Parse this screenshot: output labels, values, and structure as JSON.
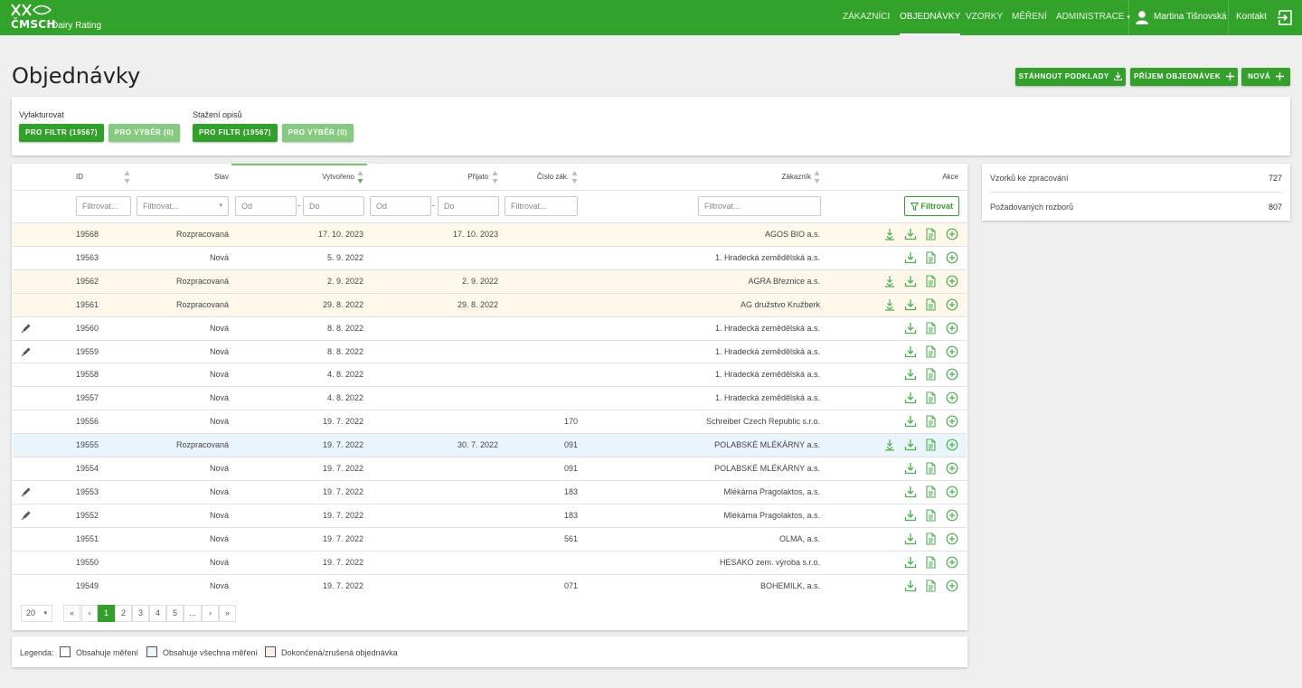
{
  "brand": {
    "logo_text": "ČMSCH",
    "subtitle": "Dairy Rating"
  },
  "nav": {
    "items": [
      "ZÁKAZNÍCI",
      "OBJEDNÁVKY",
      "VZORKY",
      "MĚŘENÍ",
      "ADMINISTRACE"
    ],
    "active": "OBJEDNÁVKY",
    "user_name": "Martina Tišnovská",
    "contact": "Kontakt"
  },
  "page_title": "Objednávky",
  "top_buttons": {
    "download": "STÁHNOUT PODKLADY",
    "receive": "PŘÍJEM OBJEDNÁVEK",
    "new": "NOVÁ"
  },
  "bulk": {
    "invoice_label": "Vyfakturovat",
    "download_label": "Stažení opisů",
    "for_filter": "PRO FILTR (19567)",
    "for_selection": "PRO VÝBĚR (0)"
  },
  "table": {
    "headers": {
      "id": "ID",
      "state": "Stav",
      "created": "Vytvořeno",
      "received": "Přijato",
      "customer_no": "Číslo zák.",
      "customer": "Zákazník",
      "actions": "Akce"
    },
    "filters": {
      "placeholder": "Filtrovat...",
      "from": "Od",
      "to": "Do",
      "dash": "-",
      "button": "Filtrovat"
    },
    "rows": [
      {
        "id": "19568",
        "state": "Rozpracovaná",
        "created": "17. 10. 2023",
        "received": "17. 10. 2023",
        "cust_no": "",
        "customer": "AGOS BIO a.s.",
        "highlight": "yellow",
        "edit": false,
        "extra_dl": true
      },
      {
        "id": "19563",
        "state": "Nová",
        "created": "5. 9. 2022",
        "received": "",
        "cust_no": "",
        "customer": "1. Hradecká zemědělská a.s.",
        "highlight": "",
        "edit": false,
        "extra_dl": false
      },
      {
        "id": "19562",
        "state": "Rozpracovaná",
        "created": "2. 9. 2022",
        "received": "2. 9. 2022",
        "cust_no": "",
        "customer": "AGRA Březnice a.s.",
        "highlight": "yellow",
        "edit": false,
        "extra_dl": true
      },
      {
        "id": "19561",
        "state": "Rozpracovaná",
        "created": "29. 8. 2022",
        "received": "29. 8. 2022",
        "cust_no": "",
        "customer": "AG družstvo Kružberk",
        "highlight": "yellow",
        "edit": false,
        "extra_dl": true
      },
      {
        "id": "19560",
        "state": "Nová",
        "created": "8. 8. 2022",
        "received": "",
        "cust_no": "",
        "customer": "1. Hradecká zemědělská a.s.",
        "highlight": "",
        "edit": true,
        "extra_dl": false
      },
      {
        "id": "19559",
        "state": "Nová",
        "created": "8. 8. 2022",
        "received": "",
        "cust_no": "",
        "customer": "1. Hradecká zemědělská a.s.",
        "highlight": "",
        "edit": true,
        "extra_dl": false
      },
      {
        "id": "19558",
        "state": "Nová",
        "created": "4. 8. 2022",
        "received": "",
        "cust_no": "",
        "customer": "1. Hradecká zemědělská a.s.",
        "highlight": "",
        "edit": false,
        "extra_dl": false
      },
      {
        "id": "19557",
        "state": "Nová",
        "created": "4. 8. 2022",
        "received": "",
        "cust_no": "",
        "customer": "1. Hradecká zemědělská a.s.",
        "highlight": "",
        "edit": false,
        "extra_dl": false
      },
      {
        "id": "19556",
        "state": "Nová",
        "created": "19. 7. 2022",
        "received": "",
        "cust_no": "170",
        "customer": "Schreiber Czech Republic s.r.o.",
        "highlight": "",
        "edit": false,
        "extra_dl": false
      },
      {
        "id": "19555",
        "state": "Rozpracovaná",
        "created": "19. 7. 2022",
        "received": "30. 7. 2022",
        "cust_no": "091",
        "customer": "POLABSKÉ MLÉKÁRNY a.s.",
        "highlight": "blue",
        "edit": false,
        "extra_dl": true
      },
      {
        "id": "19554",
        "state": "Nová",
        "created": "19. 7. 2022",
        "received": "",
        "cust_no": "091",
        "customer": "POLABSKÉ MLÉKÁRNY a.s.",
        "highlight": "",
        "edit": false,
        "extra_dl": false
      },
      {
        "id": "19553",
        "state": "Nová",
        "created": "19. 7. 2022",
        "received": "",
        "cust_no": "183",
        "customer": "Mlékárna Pragolaktos, a.s.",
        "highlight": "",
        "edit": true,
        "extra_dl": false
      },
      {
        "id": "19552",
        "state": "Nová",
        "created": "19. 7. 2022",
        "received": "",
        "cust_no": "183",
        "customer": "Mlékárna Pragolaktos, a.s.",
        "highlight": "",
        "edit": true,
        "extra_dl": false
      },
      {
        "id": "19551",
        "state": "Nová",
        "created": "19. 7. 2022",
        "received": "",
        "cust_no": "561",
        "customer": "OLMA, a.s.",
        "highlight": "",
        "edit": false,
        "extra_dl": false
      },
      {
        "id": "19550",
        "state": "Nová",
        "created": "19. 7. 2022",
        "received": "",
        "cust_no": "",
        "customer": "HESAKO zem. výroba s.r.o.",
        "highlight": "",
        "edit": false,
        "extra_dl": false
      },
      {
        "id": "19549",
        "state": "Nová",
        "created": "19. 7. 2022",
        "received": "",
        "cust_no": "071",
        "customer": "BOHEMILK, a.s.",
        "highlight": "",
        "edit": false,
        "extra_dl": false
      }
    ]
  },
  "pagination": {
    "page_size": "20",
    "pages": [
      "«",
      "‹",
      "1",
      "2",
      "3",
      "4",
      "5",
      "...",
      "›",
      "»"
    ],
    "current": "1"
  },
  "stats": {
    "samples_label": "Vzorků ke zpracování",
    "samples_value": "727",
    "analyses_label": "Požadovaných rozborů",
    "analyses_value": "807"
  },
  "legend": {
    "label": "Legenda:",
    "items": [
      {
        "text": "Obsahuje měření",
        "color": "#ffffff"
      },
      {
        "text": "Obsahuje všechna měření",
        "color": "#eaf4fb"
      },
      {
        "text": "Dokončená/zrušená objednávka",
        "color": "#fdf0ea"
      }
    ]
  },
  "colors": {
    "brand_green": "#32a22a",
    "button_green": "#33a02c",
    "icon_green": "#4caf50"
  }
}
